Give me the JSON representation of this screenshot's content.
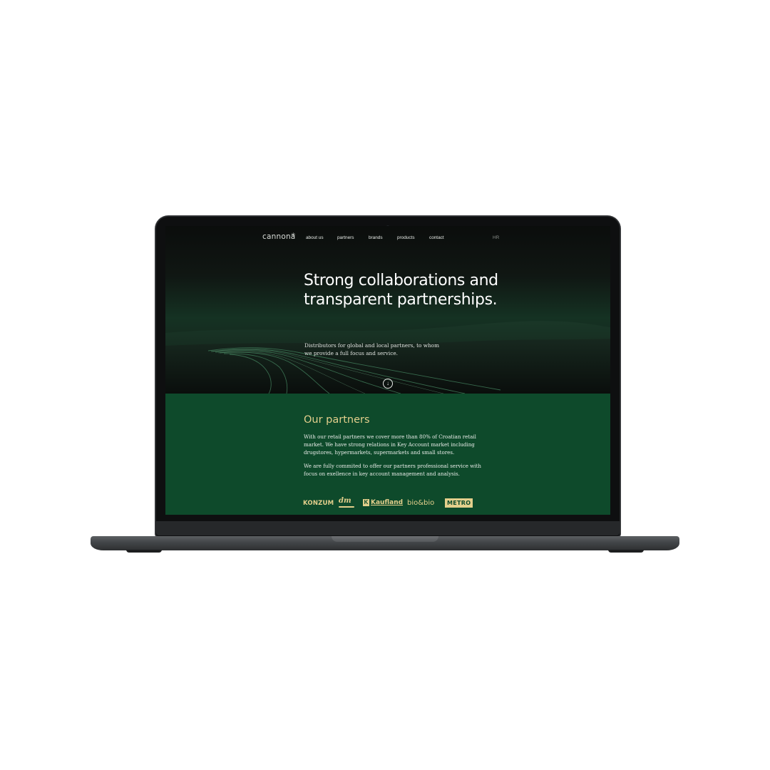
{
  "brand": {
    "logo_text": "cannona",
    "logo_mark": "✳"
  },
  "nav": {
    "items": [
      {
        "label": "about us"
      },
      {
        "label": "partners"
      },
      {
        "label": "brands"
      },
      {
        "label": "products"
      },
      {
        "label": "contact"
      }
    ],
    "language": "HR"
  },
  "hero": {
    "title": "Strong collaborations and transparent partnerships.",
    "subtitle": "Distributors for global and local partners, to whom we provide a full focus and service.",
    "scroll_icon": "arrow-down-circle-icon",
    "scroll_glyph": "↓"
  },
  "partners": {
    "title": "Our partners",
    "paragraph_1": "With our retail partners we cover more than 80% of Croatian retail market. We have strong relations in Key Account market including drugstores, hypermarkets, supermarkets and small stores.",
    "paragraph_2": "We are fully commited to offer our partners professional service with focus on exellence in key account management and analysis.",
    "logos": {
      "konzum": "KONZUM",
      "dm": "dm",
      "kaufland_mark": "K",
      "kaufland": "Kaufland",
      "biobio": "bio&bio",
      "metro": "METRO"
    }
  },
  "colors": {
    "accent_gold": "#e3cf8c",
    "section_green": "#0e4a2b",
    "hero_dark": "#0b0d0c"
  }
}
